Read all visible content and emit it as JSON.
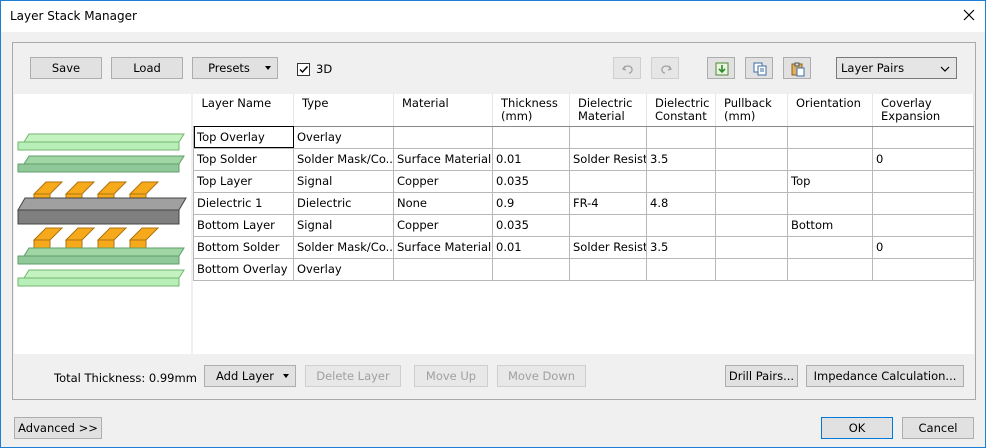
{
  "window": {
    "title": "Layer Stack Manager"
  },
  "toolbar": {
    "save": "Save",
    "load": "Load",
    "presets": "Presets",
    "threed_label": "3D",
    "threed_checked": true,
    "view_select": "Layer Pairs"
  },
  "icons": {
    "close": "close-icon",
    "undo": "undo-icon",
    "redo": "redo-icon",
    "import": "import-icon",
    "copy": "copy-icon",
    "paste": "paste-icon",
    "dropdown": "chevron-down-icon"
  },
  "colors": {
    "overlay_layer": "#b8efb8",
    "solder_layer": "#8fc99a",
    "copper": "#f6a91a",
    "dielectric": "#7f7f7f",
    "accent_border": "#1c7ed6"
  },
  "table": {
    "headers": [
      "Layer Name",
      "Type",
      "Material",
      "Thickness (mm)",
      "Dielectric Material",
      "Dielectric Constant",
      "Pullback (mm)",
      "Orientation",
      "Coverlay Expansion"
    ],
    "rows": [
      [
        "Top Overlay",
        "Overlay",
        "",
        "",
        "",
        "",
        "",
        "",
        ""
      ],
      [
        "Top Solder",
        "Solder Mask/Co...",
        "Surface Material",
        "0.01",
        "Solder Resist",
        "3.5",
        "",
        "",
        "0"
      ],
      [
        "Top Layer",
        "Signal",
        "Copper",
        "0.035",
        "",
        "",
        "",
        "Top",
        ""
      ],
      [
        "Dielectric 1",
        "Dielectric",
        "None",
        "0.9",
        "FR-4",
        "4.8",
        "",
        "",
        ""
      ],
      [
        "Bottom Layer",
        "Signal",
        "Copper",
        "0.035",
        "",
        "",
        "",
        "Bottom",
        ""
      ],
      [
        "Bottom Solder",
        "Solder Mask/Co...",
        "Surface Material",
        "0.01",
        "Solder Resist",
        "3.5",
        "",
        "",
        "0"
      ],
      [
        "Bottom Overlay",
        "Overlay",
        "",
        "",
        "",
        "",
        "",
        "",
        ""
      ]
    ]
  },
  "bottom": {
    "total_thickness": "Total Thickness: 0.99mm",
    "add_layer": "Add Layer",
    "delete_layer": "Delete Layer",
    "move_up": "Move Up",
    "move_down": "Move Down",
    "drill_pairs": "Drill Pairs...",
    "impedance": "Impedance Calculation..."
  },
  "footer": {
    "advanced": "Advanced >>",
    "ok": "OK",
    "cancel": "Cancel"
  }
}
